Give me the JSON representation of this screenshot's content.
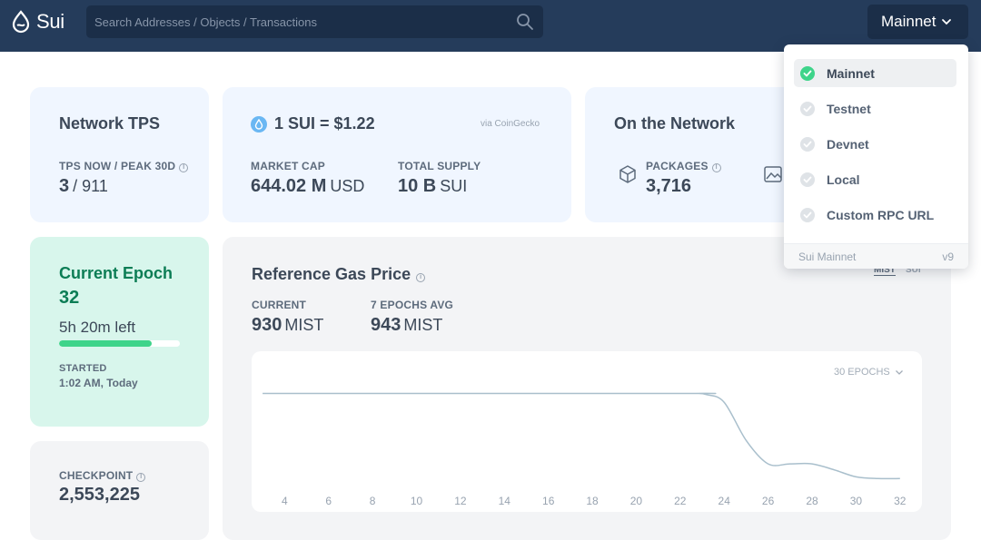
{
  "header": {
    "logo_text": "Sui",
    "search_placeholder": "Search Addresses / Objects / Transactions",
    "network_label": "Mainnet"
  },
  "tps": {
    "title": "Network TPS",
    "label": "TPS NOW / PEAK 30D",
    "now": "3",
    "peak": "/ 911"
  },
  "price": {
    "title": "1 SUI = $1.22",
    "source": "via CoinGecko",
    "market_cap_label": "MARKET CAP",
    "market_cap_value": "644.02 M",
    "market_cap_unit": "USD",
    "supply_label": "TOTAL SUPPLY",
    "supply_value": "10 B",
    "supply_unit": "SUI"
  },
  "network": {
    "title": "On the Network",
    "packages_label": "PACKAGES",
    "packages_value": "3,716"
  },
  "epoch": {
    "title": "Current Epoch",
    "number": "32",
    "time_left": "5h 20m left",
    "progress": 0.77,
    "started_label": "STARTED",
    "started_value": "1:02 AM, Today"
  },
  "checkpoint": {
    "label": "CHECKPOINT",
    "value": "2,553,225"
  },
  "gas": {
    "title": "Reference Gas Price",
    "toggle_mist": "MIST",
    "toggle_sui": "SUI",
    "current_label": "CURRENT",
    "current_value": "930",
    "current_unit": "MIST",
    "avg_label": "7 EPOCHS AVG",
    "avg_value": "943",
    "avg_unit": "MIST",
    "range_label": "30 EPOCHS"
  },
  "chart_data": {
    "type": "line",
    "x_ticks": [
      "4",
      "6",
      "8",
      "10",
      "12",
      "14",
      "16",
      "18",
      "20",
      "22",
      "24",
      "26",
      "28",
      "30",
      "32"
    ],
    "x": [
      3,
      22,
      22.7,
      23.2,
      24,
      25,
      26,
      27,
      28,
      29,
      30,
      31,
      32
    ],
    "y": [
      1000,
      1000,
      1000,
      998,
      985,
      920,
      880,
      880,
      880,
      870,
      858,
      855,
      855
    ],
    "ylim": [
      840,
      1010
    ],
    "xlim": [
      2.5,
      33
    ],
    "grid": false,
    "color": "#a9bfcc"
  },
  "dropdown": {
    "items": [
      {
        "label": "Mainnet",
        "active": true
      },
      {
        "label": "Testnet",
        "active": false
      },
      {
        "label": "Devnet",
        "active": false
      },
      {
        "label": "Local",
        "active": false
      },
      {
        "label": "Custom RPC URL",
        "active": false
      }
    ],
    "footer_left": "Sui Mainnet",
    "footer_right": "v9"
  },
  "colors": {
    "header": "#253c5b",
    "accent_green": "#3ed48a",
    "epoch_text": "#0c7d55"
  }
}
